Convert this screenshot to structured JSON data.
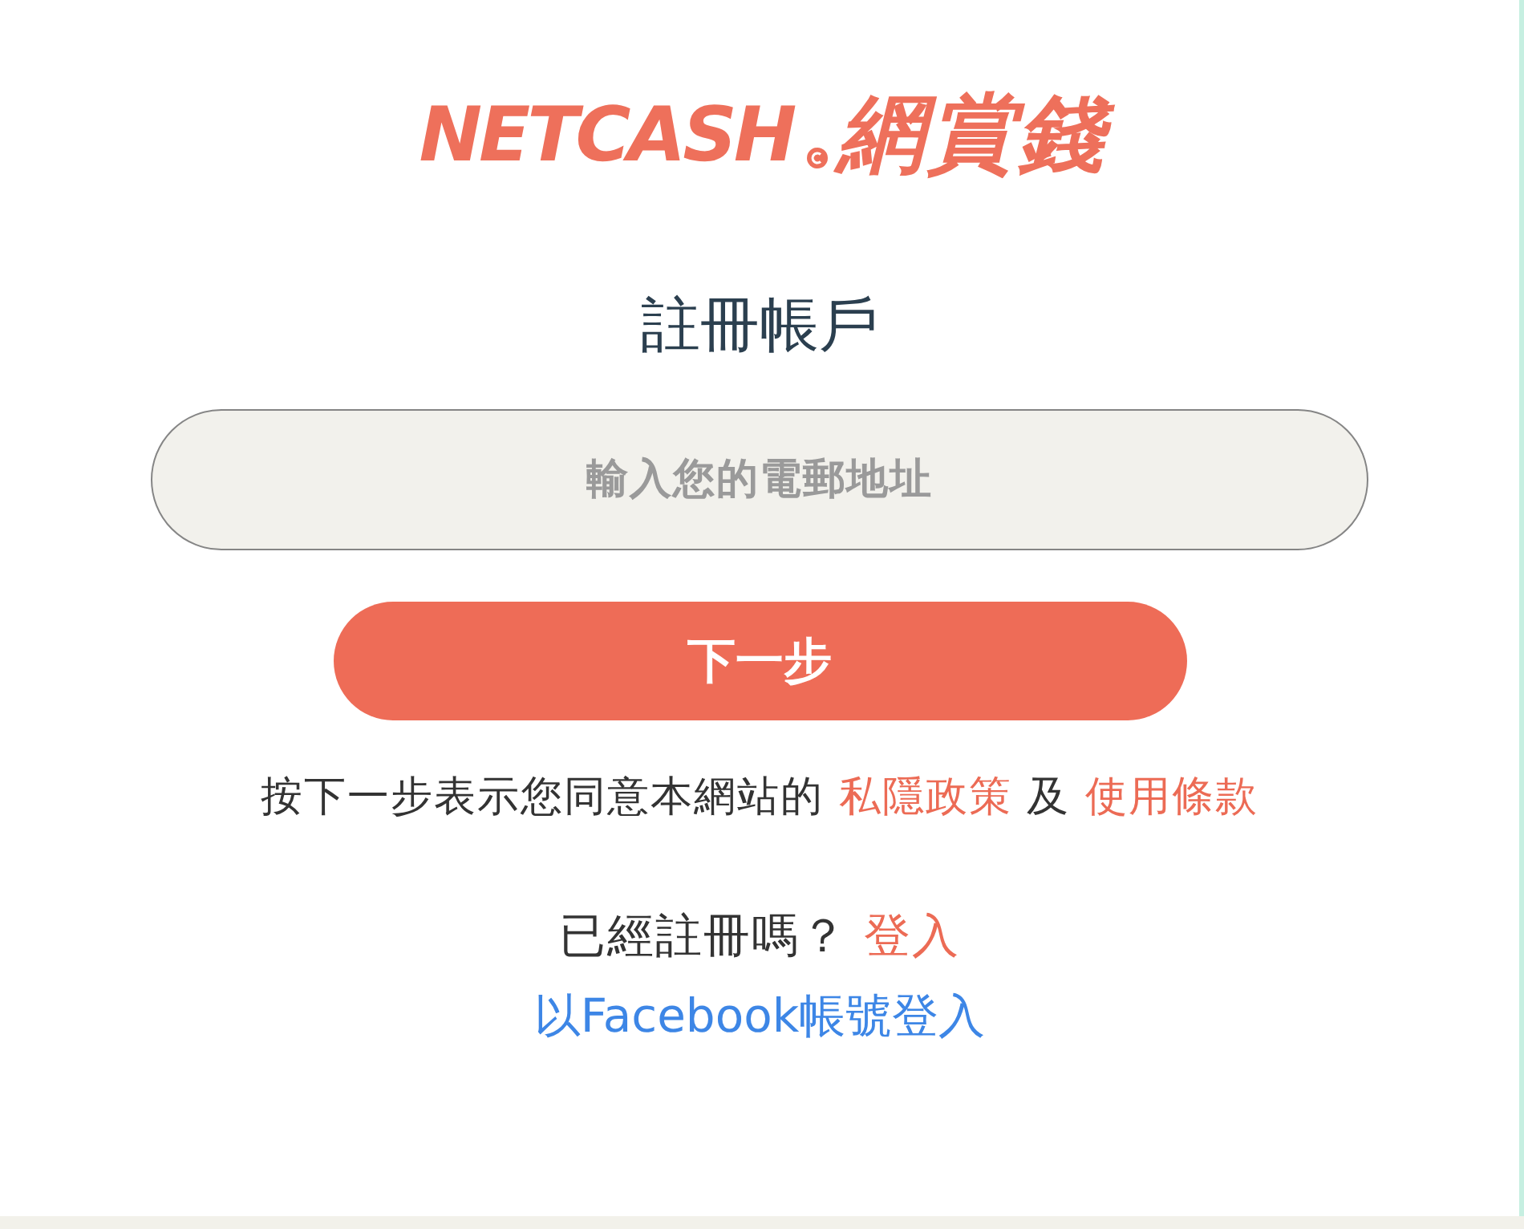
{
  "logo": {
    "latin": "NETCASH",
    "chinese": "網賞錢"
  },
  "title": "註冊帳戶",
  "email_field": {
    "placeholder": "輸入您的電郵地址"
  },
  "next_button": "下一步",
  "terms": {
    "text": "按下一步表示您同意本網站的",
    "privacy_link": "私隱政策",
    "conjunction": "及",
    "terms_link": "使用條款"
  },
  "login_prompt": {
    "text": "已經註冊嗎？",
    "login_link": "登入"
  },
  "facebook_link": "以Facebook帳號登入"
}
